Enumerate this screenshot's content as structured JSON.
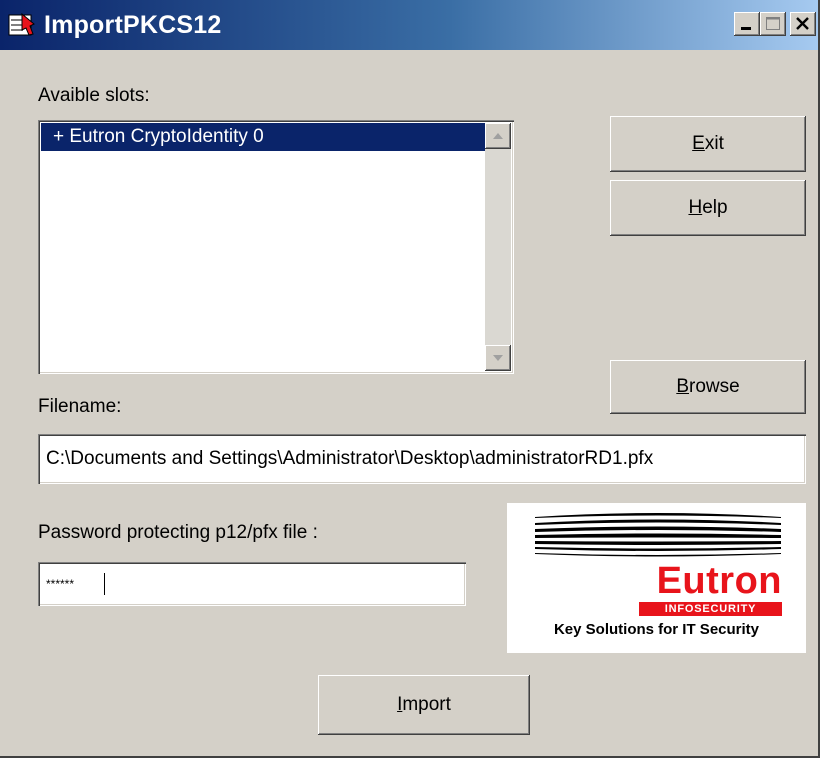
{
  "window": {
    "title": "ImportPKCS12"
  },
  "slots": {
    "label": "Avaible slots:",
    "items": [
      "+ Eutron CryptoIdentity 0"
    ]
  },
  "buttons": {
    "exit": {
      "prefix": "",
      "accel": "E",
      "rest": "xit"
    },
    "help": {
      "prefix": "",
      "accel": "H",
      "rest": "elp"
    },
    "browse": {
      "prefix": "",
      "accel": "B",
      "rest": "rowse"
    },
    "import": {
      "prefix": "",
      "accel": "I",
      "rest": "mport"
    }
  },
  "filename": {
    "label": "Filename:",
    "value": "C:\\Documents and Settings\\Administrator\\Desktop\\administratorRD1.pfx"
  },
  "password": {
    "label": "Password protecting p12/pfx file :",
    "value": "******"
  },
  "logo": {
    "brand": "Eutron",
    "subtitle": "INFOSECURITY",
    "tagline": "Key Solutions for IT Security"
  },
  "colors": {
    "titlebar_start": "#0a246a",
    "titlebar_end": "#a6caf0",
    "selection": "#0a246a",
    "brand_red": "#e8141b",
    "face": "#d4d0c8"
  }
}
